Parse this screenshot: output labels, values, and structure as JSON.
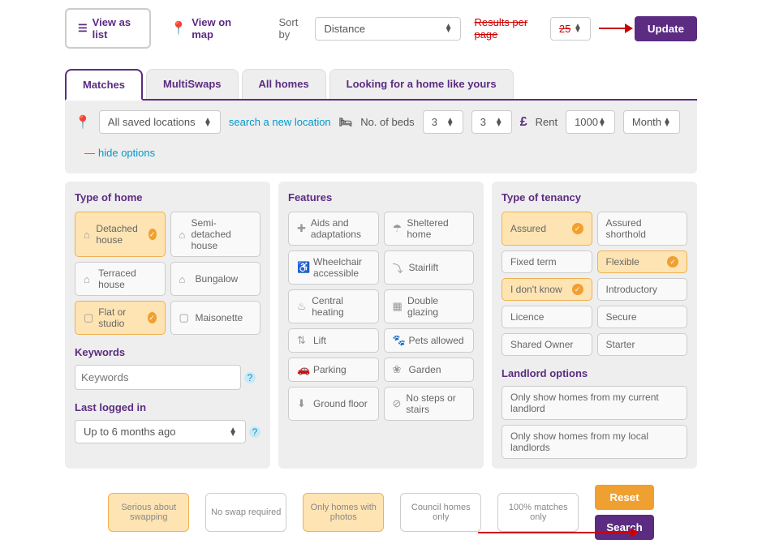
{
  "topbar": {
    "view_list": "View as list",
    "view_map": "View on map",
    "sort_by_label": "Sort by",
    "sort_by_value": "Distance",
    "results_label": "Results per page",
    "results_value": "25",
    "update": "Update"
  },
  "tabs": [
    "Matches",
    "MultiSwaps",
    "All homes",
    "Looking for a home like yours"
  ],
  "filters": {
    "location_value": "All saved locations",
    "search_new": "search a new location",
    "beds_label": "No. of beds",
    "beds_min": "3",
    "beds_max": "3",
    "rent_label": "Rent",
    "rent_value": "1000",
    "rent_period": "Month",
    "hide_options": "hide options"
  },
  "type_of_home": {
    "title": "Type of home",
    "items": [
      {
        "label": "Detached house",
        "selected": true
      },
      {
        "label": "Semi-detached house",
        "selected": false
      },
      {
        "label": "Terraced house",
        "selected": false
      },
      {
        "label": "Bungalow",
        "selected": false
      },
      {
        "label": "Flat or studio",
        "selected": true
      },
      {
        "label": "Maisonette",
        "selected": false
      }
    ]
  },
  "keywords": {
    "title": "Keywords",
    "placeholder": "Keywords"
  },
  "last_logged": {
    "title": "Last logged in",
    "value": "Up to 6 months ago"
  },
  "features": {
    "title": "Features",
    "items": [
      "Aids and adaptations",
      "Sheltered home",
      "Wheelchair accessible",
      "Stairlift",
      "Central heating",
      "Double glazing",
      "Lift",
      "Pets allowed",
      "Parking",
      "Garden",
      "Ground floor",
      "No steps or stairs"
    ]
  },
  "tenancy": {
    "title": "Type of tenancy",
    "items": [
      {
        "label": "Assured",
        "selected": true
      },
      {
        "label": "Assured shorthold",
        "selected": false
      },
      {
        "label": "Fixed term",
        "selected": false
      },
      {
        "label": "Flexible",
        "selected": true
      },
      {
        "label": "I don't know",
        "selected": true
      },
      {
        "label": "Introductory",
        "selected": false
      },
      {
        "label": "Licence",
        "selected": false
      },
      {
        "label": "Secure",
        "selected": false
      },
      {
        "label": "Shared Owner",
        "selected": false
      },
      {
        "label": "Starter",
        "selected": false
      }
    ]
  },
  "landlord": {
    "title": "Landlord options",
    "items": [
      "Only show homes from my current landlord",
      "Only show homes from my local landlords"
    ]
  },
  "bottom": {
    "chips": [
      {
        "label": "Serious about swapping",
        "style": "orange"
      },
      {
        "label": "No swap required",
        "style": "grey"
      },
      {
        "label": "Only homes with photos",
        "style": "orange"
      },
      {
        "label": "Council homes only",
        "style": "grey"
      },
      {
        "label": "100% matches only",
        "style": "grey"
      }
    ],
    "reset": "Reset",
    "search": "Search"
  }
}
